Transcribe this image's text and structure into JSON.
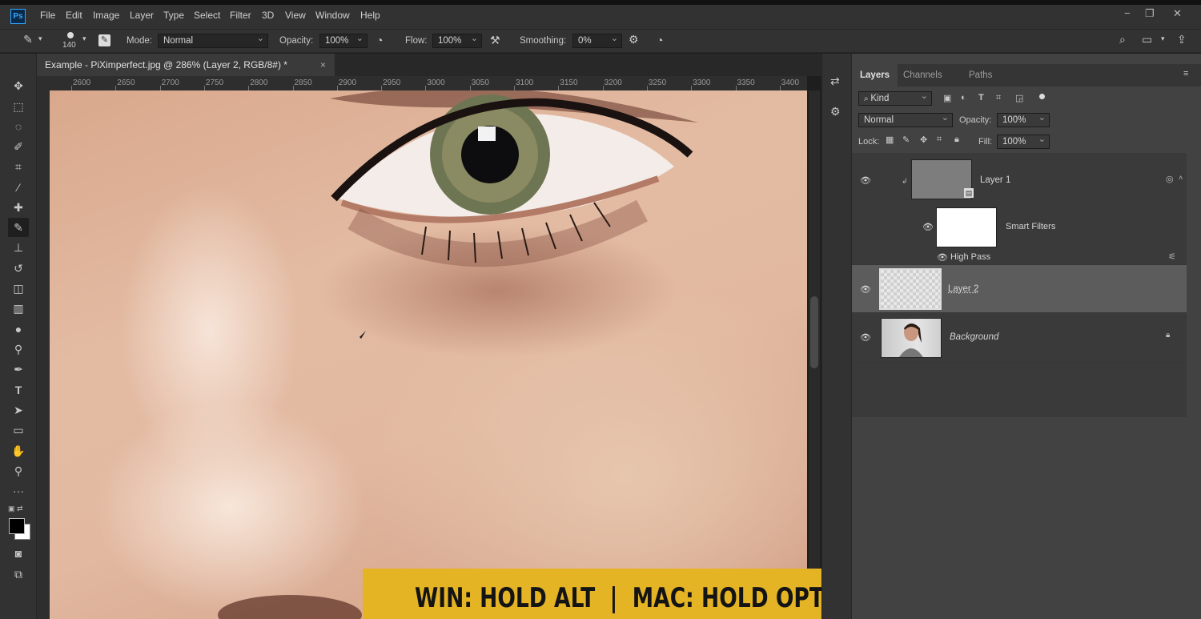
{
  "app": {
    "logo": "Ps"
  },
  "menu": [
    "File",
    "Edit",
    "Image",
    "Layer",
    "Type",
    "Select",
    "Filter",
    "3D",
    "View",
    "Window",
    "Help"
  ],
  "window_controls": {
    "minimize": "−",
    "restore": "❐",
    "close": "✕"
  },
  "options": {
    "brush_size": "140",
    "mode_label": "Mode:",
    "mode_value": "Normal",
    "opacity_label": "Opacity:",
    "opacity_value": "100%",
    "flow_label": "Flow:",
    "flow_value": "100%",
    "smoothing_label": "Smoothing:",
    "smoothing_value": "0%"
  },
  "document": {
    "tab_title": "Example - PiXimperfect.jpg @ 286% (Layer 2, RGB/8#) *",
    "close": "×"
  },
  "ruler": [
    "2600",
    "2650",
    "2700",
    "2750",
    "2800",
    "2850",
    "2900",
    "2950",
    "3000",
    "3050",
    "3100",
    "3150",
    "3200",
    "3250",
    "3300",
    "3350",
    "3400"
  ],
  "layers_panel": {
    "tabs": [
      "Layers",
      "Channels",
      "Paths"
    ],
    "filter_kind": "Kind",
    "blend_mode": "Normal",
    "opacity_label": "Opacity:",
    "opacity_value": "100%",
    "lock_label": "Lock:",
    "fill_label": "Fill:",
    "fill_value": "100%",
    "layers": [
      {
        "name": "Layer 1"
      },
      {
        "name": "Smart Filters"
      },
      {
        "name": "High Pass"
      },
      {
        "name": "Layer 2"
      },
      {
        "name": "Background"
      }
    ]
  },
  "caption": "WIN: HOLD ALT  |  MAC: HOLD OPTION",
  "colors": {
    "accent": "#31a8ff",
    "caption_bg": "#e5b424",
    "ui_bg": "#323232",
    "panel_bg": "#424242"
  }
}
